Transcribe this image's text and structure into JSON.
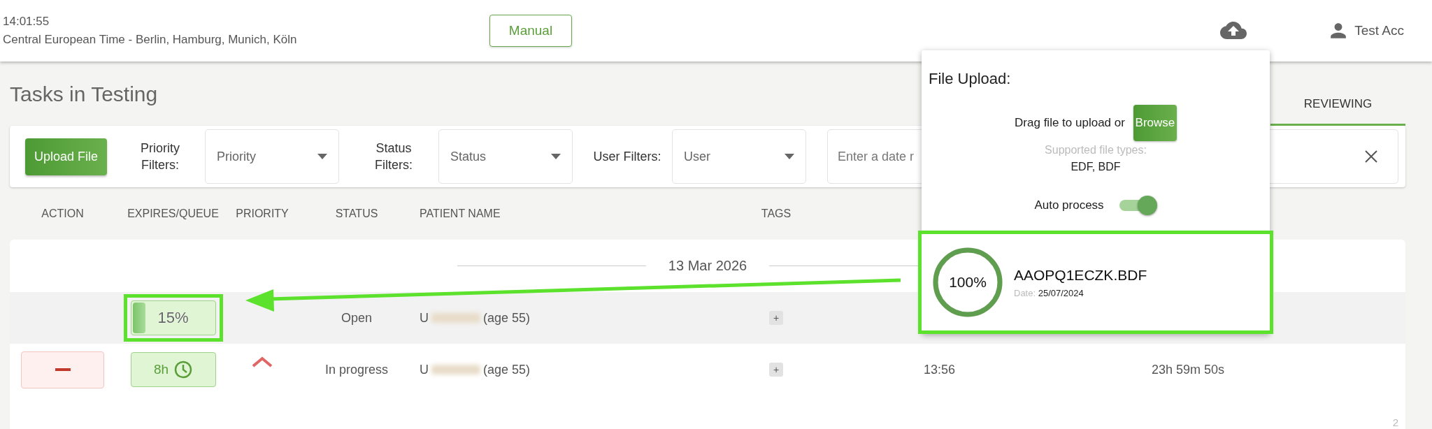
{
  "header": {
    "time": "14:01:55",
    "timezone": "Central European Time - Berlin, Hamburg, Munich, Köln",
    "manual_button": "Manual",
    "user": "Test Acc"
  },
  "title": "Tasks in Testing",
  "tabs": [
    {
      "label": "REVIEWING",
      "selected": true
    }
  ],
  "filters": {
    "upload_button": "Upload File",
    "selects": [
      {
        "label": "Priority Filters:",
        "placeholder": "Priority"
      },
      {
        "label": "Status Filters:",
        "placeholder": "Status"
      },
      {
        "label": "User Filters:",
        "placeholder": "User"
      }
    ],
    "date_field": {
      "placeholder": "Enter a date r"
    }
  },
  "table": {
    "columns": [
      "ACTION",
      "EXPIRES/QUEUE",
      "PRIORITY",
      "STATUS",
      "PATIENT NAME",
      "TAGS"
    ],
    "date_separator": "13 Mar 2026",
    "rows": [
      {
        "highlighted": true,
        "queue": {
          "kind": "progress",
          "level": 0.15,
          "text": "15%"
        },
        "status": "Open",
        "patient": {
          "initial": "U",
          "redacted": true,
          "age": "(age 55)"
        },
        "tag_button": "+"
      },
      {
        "highlighted": false,
        "action": {
          "kind": "remove"
        },
        "queue": {
          "kind": "timer",
          "text": "8h"
        },
        "priority": {
          "kind": "high"
        },
        "status": "In progress",
        "patient": {
          "initial": "U",
          "redacted": true,
          "age": "(age 55)"
        },
        "tag_button": "+",
        "column_7": "13:56",
        "column_8": "23h 59m 50s"
      }
    ],
    "page": "2"
  },
  "upload_popup": {
    "title": "File Upload:",
    "drag_text": "Drag file to upload or",
    "browse_button": "Browse",
    "supported_label": "Supported file types:",
    "supported_types": "EDF, BDF",
    "auto_process": {
      "label": "Auto process",
      "on": true
    },
    "files": [
      {
        "name": "AAOPQ1ECZK.BDF",
        "level": 1,
        "percent": "100%",
        "date_label": "Date:",
        "date": "25/07/2024",
        "highlighted": true
      }
    ]
  },
  "annotation_arrow": true
}
